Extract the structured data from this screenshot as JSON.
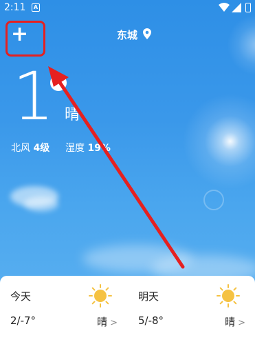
{
  "status": {
    "time": "2:11",
    "notif_glyph": "A"
  },
  "header": {
    "city": "东城",
    "add_label": "+"
  },
  "current": {
    "temp": "1",
    "condition": "晴",
    "wind_label": "北风",
    "wind_value": "4级",
    "humidity_label": "湿度",
    "humidity_value": "19%"
  },
  "forecast": [
    {
      "label": "今天",
      "range": "2/-7°",
      "condition": "晴",
      "icon": "sun-icon"
    },
    {
      "label": "明天",
      "range": "5/-8°",
      "condition": "晴",
      "icon": "sun-icon"
    }
  ],
  "colors": {
    "highlight": "#e52020",
    "sky": "#3a98ea",
    "sun": "#f5c242"
  }
}
